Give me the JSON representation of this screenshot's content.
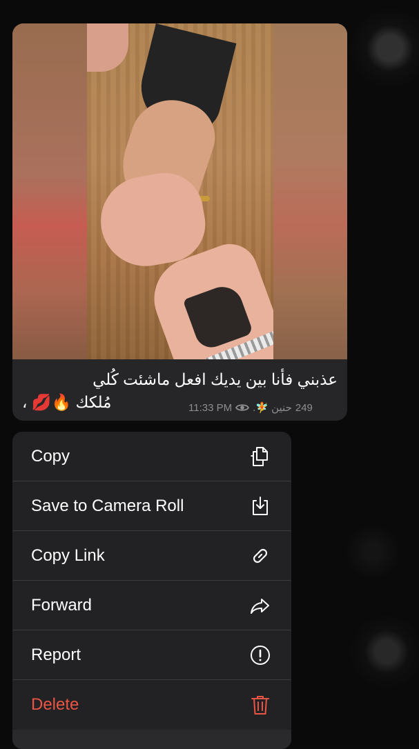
{
  "message": {
    "caption_line1": "عذبني فأنا بين يديك افعل ماشئت كُلي",
    "caption_line2": "مُلكك 🔥💋 ،",
    "views": "249",
    "author_signature": "حنين 🧚.",
    "time": "11:33 PM"
  },
  "menu": {
    "items": [
      {
        "label": "Copy",
        "icon": "copy-icon"
      },
      {
        "label": "Save to Camera Roll",
        "icon": "save-download-icon"
      },
      {
        "label": "Copy Link",
        "icon": "link-icon"
      },
      {
        "label": "Forward",
        "icon": "forward-arrow-icon"
      },
      {
        "label": "Report",
        "icon": "exclamation-circle-icon"
      },
      {
        "label": "Delete",
        "icon": "trash-icon"
      }
    ],
    "colors": {
      "danger": "#eb5545",
      "text": "#ffffff",
      "background": "#222224"
    }
  }
}
